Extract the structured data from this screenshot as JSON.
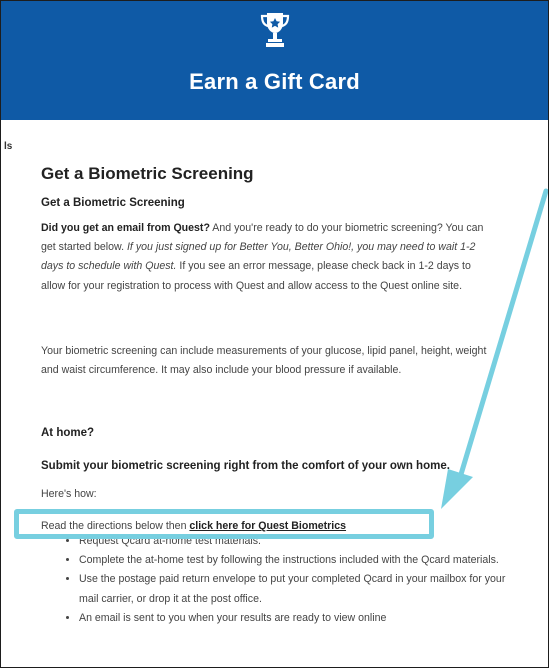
{
  "header": {
    "title": "Earn a Gift Card",
    "icon": "trophy-icon",
    "background": "#0f5aa6"
  },
  "breadcrumb_fragment": "ls",
  "section": {
    "title": "Get a Biometric Screening",
    "subtitle": "Get a Biometric Screening",
    "p1_bold": "Did you get an email from Quest?",
    "p1_text1": " And you're ready to do your biometric screening? You can get started below. ",
    "p1_italic": "If you just signed up for Better You, Better Ohio!, you may need to wait 1-2 days to schedule with Quest.",
    "p1_text2": " If you see an error message, please check back in 1-2 days to allow for your registration to process with Quest and allow access to the Quest online site.",
    "p2": "Your biometric screening can include measurements of your glucose, lipid panel, height, weight and waist circumference. It may also include your blood pressure if available.",
    "at_home_heading": "At home?",
    "at_home_sub": "Submit your biometric screening right from the comfort of your own home.",
    "heres_how": "Here's how:",
    "directions_text": "Read the directions below then ",
    "directions_link": "click here for Quest Biometrics",
    "steps": [
      "Request Qcard at-home test materials.",
      "Complete the at-home test by following the instructions included with the Qcard materials.",
      "Use the postage paid return envelope to put your completed Qcard in your mailbox for your mail carrier, or drop it at the post office.",
      "An email is sent to you when your results are ready to view online"
    ]
  },
  "annotation": {
    "color": "#77cfe0"
  }
}
